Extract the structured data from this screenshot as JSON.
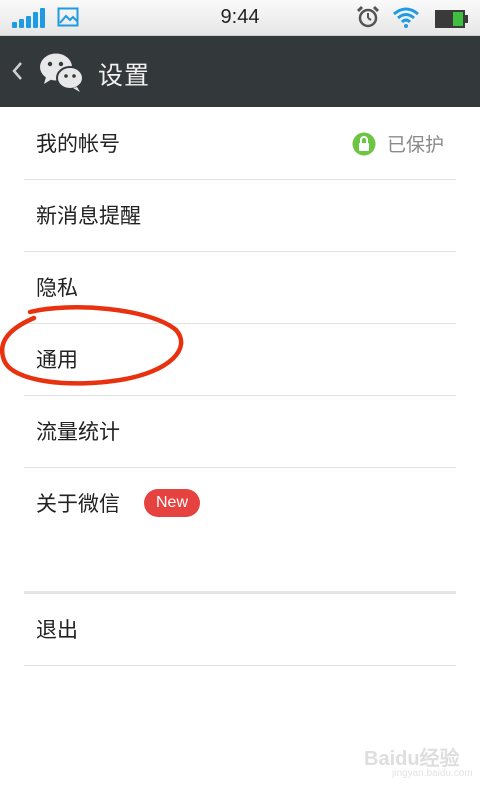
{
  "status_bar": {
    "time": "9:44",
    "signal_bars": 5,
    "colors": {
      "signal": "#1f9be3",
      "battery": "#3fbf3f"
    }
  },
  "header": {
    "title": "设置",
    "icons": [
      "back-chevron-icon",
      "wechat-logo-icon"
    ],
    "background": "#33383b"
  },
  "settings": {
    "items": [
      {
        "label": "我的帐号",
        "status": "已保护",
        "status_icon": "lock-icon"
      },
      {
        "label": "新消息提醒"
      },
      {
        "label": "隐私"
      },
      {
        "label": "通用"
      },
      {
        "label": "流量统计"
      },
      {
        "label": "关于微信",
        "badge": "New"
      }
    ],
    "logout": "退出",
    "colors": {
      "badge": "#e64340",
      "protected_icon": "#6cc644"
    }
  },
  "annotation": {
    "color": "#e8320f",
    "target": "通用"
  },
  "watermark": {
    "text": "Baidu经验",
    "sub": "jingyan.baidu.com"
  }
}
